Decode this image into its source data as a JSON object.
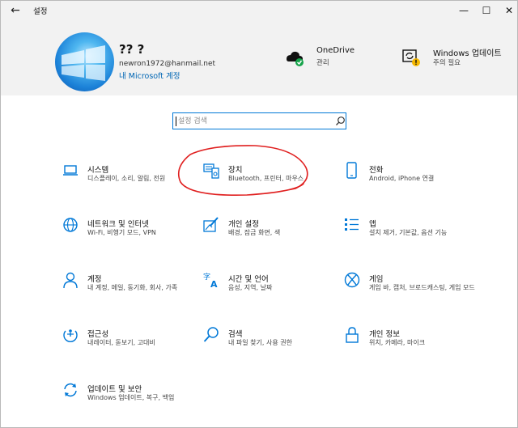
{
  "window": {
    "title": "설정",
    "back_glyph": "←",
    "minimize_glyph": "—",
    "maximize_glyph": "☐",
    "close_glyph": "✕"
  },
  "account": {
    "name": "?? ?",
    "email": "newron1972@hanmail.net",
    "link": "내 Microsoft 계정"
  },
  "header_items": {
    "onedrive": {
      "title": "OneDrive",
      "subtitle": "관리",
      "icon": "onedrive-cloud-icon",
      "badge_color": "#16a34a"
    },
    "windows_update": {
      "title": "Windows 업데이트",
      "subtitle": "주의 필요",
      "icon": "windows-update-icon",
      "badge_color": "#f5b800"
    }
  },
  "search": {
    "placeholder": "설정 검색",
    "icon": "search-icon"
  },
  "categories": [
    {
      "title": "시스템",
      "desc": "디스플레이, 소리, 알림, 전원",
      "icon": "laptop-icon"
    },
    {
      "title": "장치",
      "desc": "Bluetooth, 프린터, 마우스",
      "icon": "keyboard-speaker-icon"
    },
    {
      "title": "전화",
      "desc": "Android, iPhone 연결",
      "icon": "phone-icon"
    },
    {
      "title": "네트워크 및 인터넷",
      "desc": "Wi-Fi, 비행기 모드, VPN",
      "icon": "globe-icon"
    },
    {
      "title": "개인 설정",
      "desc": "배경, 잠금 화면, 색",
      "icon": "paint-pen-icon"
    },
    {
      "title": "앱",
      "desc": "설치 제거, 기본값, 옵션 기능",
      "icon": "apps-list-icon"
    },
    {
      "title": "계정",
      "desc": "내 계정, 메일, 동기화, 회사, 가족",
      "icon": "person-icon"
    },
    {
      "title": "시간 및 언어",
      "desc": "음성, 지역, 날짜",
      "icon": "time-language-icon"
    },
    {
      "title": "게임",
      "desc": "게임 바, 캡처, 브로드캐스팅, 게임 모드",
      "icon": "xbox-icon"
    },
    {
      "title": "접근성",
      "desc": "내레이터, 돋보기, 고대비",
      "icon": "ease-of-access-icon"
    },
    {
      "title": "검색",
      "desc": "내 파일 찾기, 사용 권한",
      "icon": "search-magnifier-icon"
    },
    {
      "title": "개인 정보",
      "desc": "위치, 카메라, 마이크",
      "icon": "lock-icon"
    },
    {
      "title": "업데이트 및 보안",
      "desc": "Windows 업데이트, 복구, 백업",
      "icon": "update-sync-icon"
    }
  ],
  "accent_color": "#0078d7",
  "annotation": {
    "shape": "hand-drawn-circle",
    "color": "#e02020",
    "target": "장치"
  }
}
